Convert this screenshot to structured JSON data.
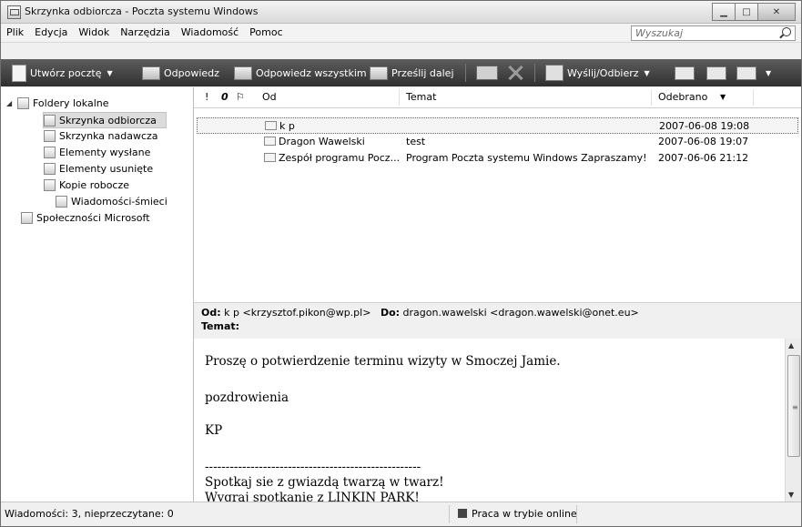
{
  "window": {
    "title": "Skrzynka odbiorcza - Poczta systemu Windows"
  },
  "menu": [
    "Plik",
    "Edycja",
    "Widok",
    "Narzędzia",
    "Wiadomość",
    "Pomoc"
  ],
  "search": {
    "placeholder": "Wyszukaj"
  },
  "toolbar": {
    "create": "Utwórz pocztę",
    "reply": "Odpowiedz",
    "reply_all": "Odpowiedz wszystkim",
    "forward": "Prześlij dalej",
    "send_receive": "Wyślij/Odbierz"
  },
  "folders": {
    "root": "Foldery lokalne",
    "items": [
      "Skrzynka odbiorcza",
      "Skrzynka nadawcza",
      "Elementy wysłane",
      "Elementy usunięte",
      "Kopie robocze",
      "Wiadomości-śmieci"
    ],
    "community": "Społeczności Microsoft"
  },
  "list": {
    "headers": {
      "important": "!",
      "attachment": "0",
      "flag": "⚐",
      "from": "Od",
      "subject": "Temat",
      "received": "Odebrano"
    },
    "rows": [
      {
        "from": "k p",
        "subject": "",
        "received": "2007-06-08 19:08"
      },
      {
        "from": "Dragon Wawelski",
        "subject": "test",
        "received": "2007-06-08 19:07"
      },
      {
        "from": "Zespół programu Pocz...",
        "subject": "Program Poczta systemu Windows  Zapraszamy!",
        "received": "2007-06-06 21:12"
      }
    ]
  },
  "preview": {
    "from_label": "Od:",
    "from": "k p <krzysztof.pikon@wp.pl>",
    "to_label": "Do:",
    "to": "dragon.wawelski <dragon.wawelski@onet.eu>",
    "subject_label": "Temat:",
    "body": [
      "Proszę o potwierdzenie terminu wizyty w Smoczej Jamie.",
      "pozdrowienia",
      "KP",
      "----------------------------------------------------",
      "Spotkaj sie z gwiazdą twarzą w twarz!",
      "Wygraj spotkanie z LINKIN PARK!"
    ]
  },
  "status": {
    "messages": "Wiadomości: 3, nieprzeczytane: 0",
    "online": "Praca w trybie online"
  }
}
